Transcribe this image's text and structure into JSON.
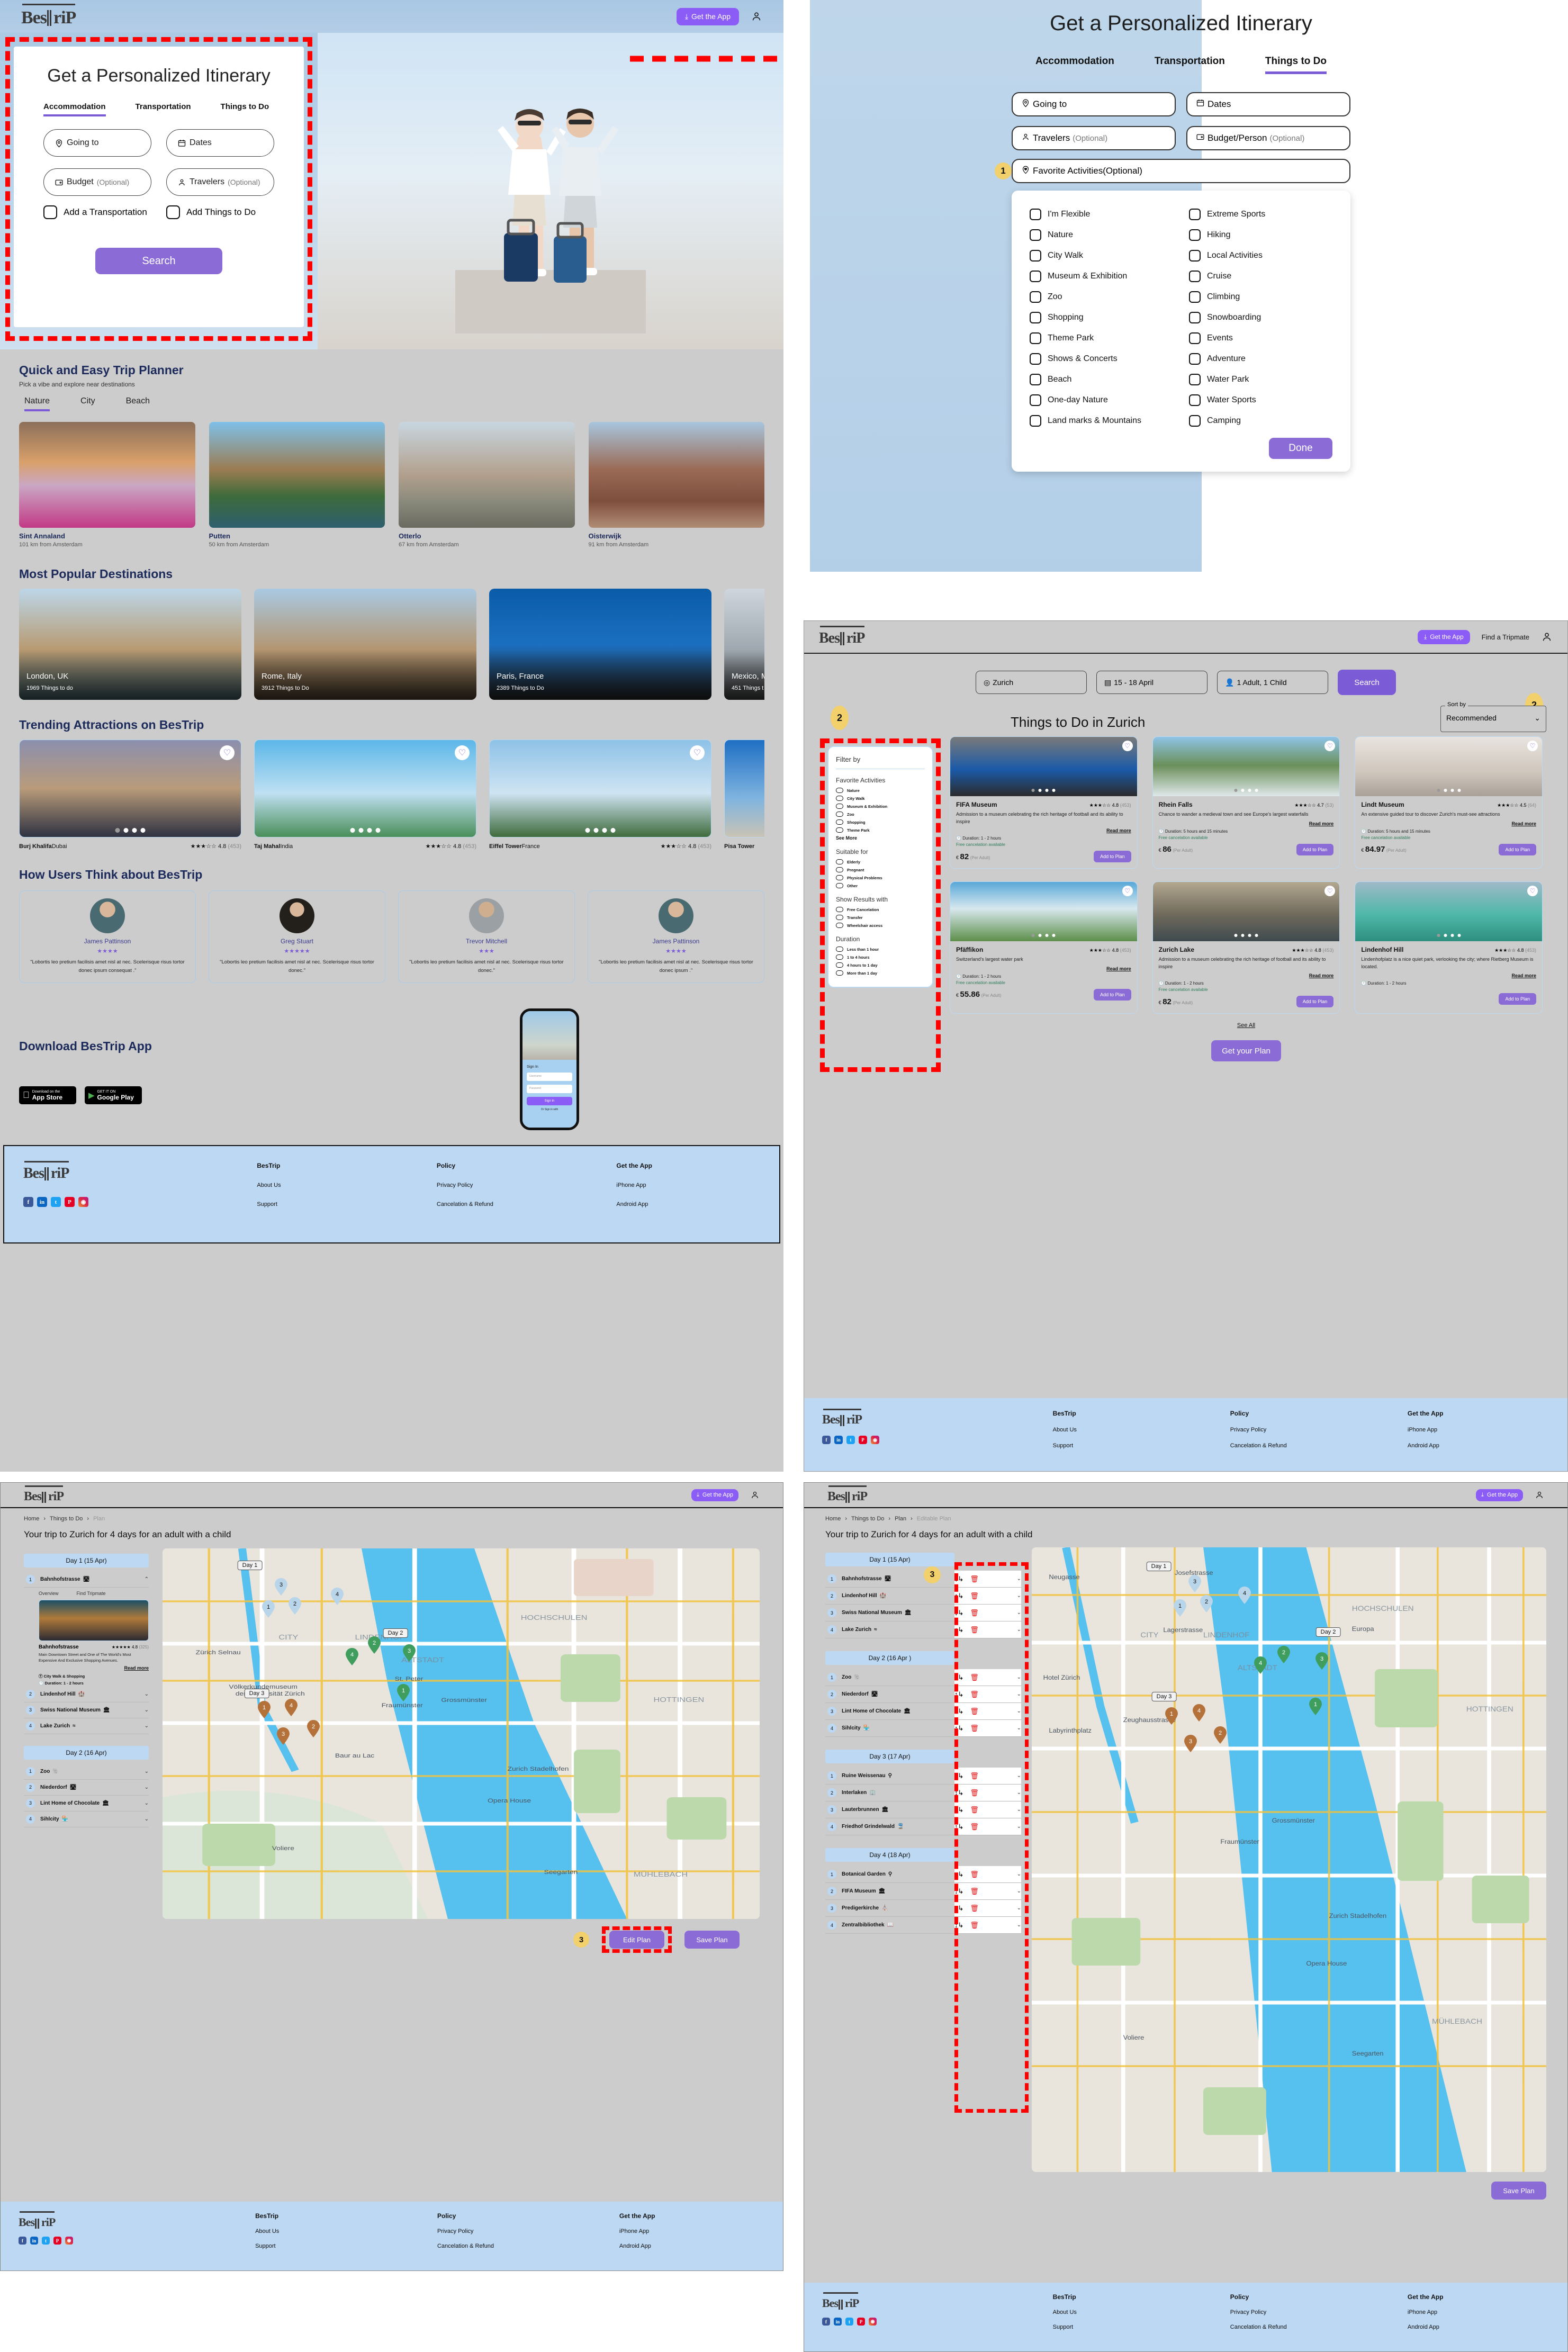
{
  "brand": {
    "name": "BesTriP",
    "get_app": "Get the App",
    "find_tripmate": "Find a Tripmate"
  },
  "home": {
    "form": {
      "title": "Get a Personalized Itinerary",
      "tabs": [
        "Accommodation",
        "Transportation",
        "Things to Do"
      ],
      "active_tab": "Accommodation",
      "fields": {
        "going_to": "Going to",
        "dates": "Dates",
        "budget": "Budget",
        "budget_opt": "(Optional)",
        "travelers": "Travelers",
        "travelers_opt": "(Optional)"
      },
      "checkboxes": [
        "Add a Transportation",
        "Add Things to Do"
      ],
      "search_button": "Search"
    },
    "planner": {
      "title": "Quick and Easy Trip Planner",
      "subtitle": "Pick a vibe and explore near destinations",
      "tabs": [
        "Nature",
        "City",
        "Beach"
      ],
      "active_tab": "Nature",
      "tiles": [
        {
          "name": "Sint Annaland",
          "distance": "101 km from Amsterdam"
        },
        {
          "name": "Putten",
          "distance": "50 km from Amsterdam"
        },
        {
          "name": "Otterlo",
          "distance": "67 km from Amsterdam"
        },
        {
          "name": "Oisterwijk",
          "distance": "91 km from Amsterdam"
        }
      ]
    },
    "popular": {
      "title": "Most Popular Destinations",
      "cards": [
        {
          "name": "London, UK",
          "count": "1969 Things to do"
        },
        {
          "name": "Rome, Italy",
          "count": "3912 Things to Do"
        },
        {
          "name": "Paris, France",
          "count": "2389 Things to Do"
        },
        {
          "name": "Mexico, M",
          "count": "451 Things t"
        }
      ]
    },
    "trending": {
      "title": "Trending Attractions on BesTrip",
      "cards": [
        {
          "name": "Burj Khalifa",
          "place": "Dubai",
          "stars": "★★★☆☆",
          "rating": "4.8",
          "reviews": "(453)"
        },
        {
          "name": "Taj Mahal",
          "place": "India",
          "stars": "★★★☆☆",
          "rating": "4.8",
          "reviews": "(453)"
        },
        {
          "name": "Eiffel Tower",
          "place": "France",
          "stars": "★★★☆☆",
          "rating": "4.8",
          "reviews": "(453)"
        },
        {
          "name": "Pisa Tower",
          "place": "",
          "stars": "",
          "rating": "",
          "reviews": ""
        }
      ]
    },
    "reviews": {
      "title": "How Users Think about BesTrip",
      "items": [
        {
          "name": "James Pattinson",
          "stars": "★★★★",
          "text": "\"Lobortis leo pretium facilisis amet nisl at nec. Scelerisque risus tortor donec ipsum consequat .\""
        },
        {
          "name": "Greg Stuart",
          "stars": "★★★★★",
          "text": "\"Lobortis leo pretium facilisis amet nisl at nec. Scelerisque risus tortor donec.\""
        },
        {
          "name": "Trevor Mitchell",
          "stars": "★★★",
          "text": "\"Lobortis leo pretium facilisis amet nisl at nec. Scelerisque risus tortor donec.\""
        },
        {
          "name": "James Pattinson",
          "stars": "★★★★",
          "text": "\"Lobortis leo pretium facilisis amet nisl at nec. Scelerisque risus tortor donec ipsum .\""
        }
      ]
    },
    "download": {
      "title": "Download BesTrip App",
      "appstore_small": "Download on the",
      "appstore_big": "App Store",
      "play_small": "GET IT ON",
      "play_big": "Google Play",
      "phone": {
        "signin": "Sign In",
        "username_placeholder": "Username",
        "password_placeholder": "Password",
        "signin_button": "Sign In",
        "note": "Or Sign in with"
      }
    }
  },
  "footer": {
    "columns": [
      {
        "heading": "BesTrip",
        "links": [
          "About Us",
          "Support"
        ]
      },
      {
        "heading": "Policy",
        "links": [
          "Privacy Policy",
          "Cancelation & Refund"
        ]
      },
      {
        "heading": "Get the App",
        "links": [
          "iPhone App",
          "Android App"
        ]
      }
    ],
    "socials": [
      "facebook-icon",
      "linkedin-icon",
      "twitter-icon",
      "pinterest-icon",
      "instagram-icon"
    ]
  },
  "itinerary_form": {
    "title": "Get a Personalized Itinerary",
    "tabs": [
      "Accommodation",
      "Transportation",
      "Things to Do"
    ],
    "active_tab": "Things to Do",
    "fields": {
      "going_to": "Going to",
      "dates": "Dates",
      "travelers": "Travelers",
      "travelers_opt": "(Optional)",
      "budget_person": "Budget/Person",
      "budget_opt": "(Optional)",
      "favorite_activities": "Favorite Activities",
      "favorite_opt": "(Optional)"
    },
    "step_badge": "1",
    "activities_left": [
      "I'm Flexible",
      "Nature",
      "City Walk",
      "Museum & Exhibition",
      "Zoo",
      "Shopping",
      "Theme Park",
      "Shows & Concerts",
      "Beach",
      "One-day Nature",
      "Land marks & Mountains"
    ],
    "activities_right": [
      "Extreme Sports",
      "Hiking",
      "Local Activities",
      "Cruise",
      "Climbing",
      "Snowboarding",
      "Events",
      "Adventure",
      "Water Park",
      "Water Sports",
      "Camping"
    ],
    "done_button": "Done"
  },
  "things_to_do": {
    "step_badge_left": "2",
    "step_badge_right": "2",
    "search": {
      "destination": "Zurich",
      "dates": "15 - 18 April",
      "travelers": "1 Adult, 1 Child",
      "button": "Search"
    },
    "heading": "Things to Do in Zurich",
    "sort": {
      "label": "Sort by",
      "value": "Recommended"
    },
    "filter": {
      "title": "Filter by",
      "groups": [
        {
          "name": "Favorite Activities",
          "options": [
            "Nature",
            "City Walk",
            "Museum & Exhibition",
            "Zoo",
            "Shopping",
            "Theme Park"
          ],
          "see_more": "See More"
        },
        {
          "name": "Suitable for",
          "options": [
            "Elderly",
            "Pregnant",
            "Physical Problems",
            "Other"
          ]
        },
        {
          "name": "Show Results with",
          "options": [
            "Free Cancelation",
            "Transfer",
            "Wheelchair access"
          ]
        },
        {
          "name": "Duration",
          "options": [
            "Less than 1 hour",
            "1 to 4 hours",
            "4 hours to 1 day",
            "More than 1 day"
          ]
        }
      ]
    },
    "cards": [
      {
        "title": "FIFA Museum",
        "stars": "★★★☆☆",
        "rating": "4.8",
        "reviews": "(453)",
        "desc": "Admission to a museum celebrating the rich heritage of football and its ability to inspire",
        "read_more": "Read more",
        "duration": "Duration: 1 - 2 hours",
        "cancel": "Free cancelation available",
        "currency": "€",
        "price": "82",
        "per": "(Per Adult)",
        "cta": "Add to Plan"
      },
      {
        "title": "Rhein Falls",
        "stars": "★★★☆☆",
        "rating": "4.7",
        "reviews": "(53)",
        "desc": "Chance to wander a medieval town and see Europe's largest waterfalls",
        "read_more": "Read more",
        "duration": "Duration: 5 hours and 15 minutes",
        "cancel": "Free cancelation available",
        "currency": "€",
        "price": "86",
        "per": "(Per Adult)",
        "cta": "Add to Plan"
      },
      {
        "title": "Lindt Museum",
        "stars": "★★★☆☆",
        "rating": "4.5",
        "reviews": "(64)",
        "desc": "An extensive guided tour to discover Zurich's must-see attractions",
        "read_more": "Read more",
        "duration": "Duration: 5 hours and 15 minutes",
        "cancel": "Free cancelation available",
        "currency": "€",
        "price": "84.97",
        "per": "(Per Adult)",
        "cta": "Add to Plan"
      },
      {
        "title": "Pfäffikon",
        "stars": "★★★☆☆",
        "rating": "4.8",
        "reviews": "(453)",
        "desc": "Switzerland's largest water park",
        "read_more": "Read more",
        "duration": "Duration: 1 - 2 hours",
        "cancel": "Free cancelation available",
        "currency": "€",
        "price": "55.86",
        "per": "(Per Adult)",
        "cta": "Add to Plan"
      },
      {
        "title": "Zurich Lake",
        "stars": "★★★☆☆",
        "rating": "4.8",
        "reviews": "(453)",
        "desc": "Admission to a museum celebrating the rich heritage of football and its ability to inspire",
        "read_more": "Read more",
        "duration": "Duration: 1 - 2 hours",
        "cancel": "Free cancelation available",
        "currency": "€",
        "price": "82",
        "per": "(Per Adult)",
        "cta": "Add to Plan"
      },
      {
        "title": "Lindenhof Hill",
        "stars": "★★★☆☆",
        "rating": "4.8",
        "reviews": "(453)",
        "desc": "Lindenhofplatz is a nice quiet park, verlooking the city; where Rietberg Museum is located.",
        "read_more": "Read more",
        "duration": "Duration: 1 - 2 hours",
        "cancel": "",
        "currency": "",
        "price": "",
        "per": "",
        "cta": "Add to Plan"
      }
    ],
    "see_all": "See All",
    "get_plan": "Get your Plan"
  },
  "plan": {
    "breadcrumb": [
      "Home",
      "Things to Do",
      "Plan"
    ],
    "title": "Your trip to Zurich for 4 days for an adult with a child",
    "step_badge": "3",
    "days": [
      {
        "label": "Day 1 (15 Apr)",
        "items": [
          {
            "n": "1",
            "name": "Bahnhofstrasse",
            "icon": "road-icon"
          },
          {
            "n": "2",
            "name": "Lindenhof Hill",
            "icon": "castle-icon"
          },
          {
            "n": "3",
            "name": "Swiss National Museum",
            "icon": "museum-icon"
          },
          {
            "n": "4",
            "name": "Lake Zurich",
            "icon": "water-icon"
          }
        ]
      },
      {
        "label": "Day 2 (16 Apr)",
        "items": [
          {
            "n": "1",
            "name": "Zoo",
            "icon": "elephant-icon"
          },
          {
            "n": "2",
            "name": "Niederdorf",
            "icon": "road-icon"
          },
          {
            "n": "3",
            "name": "Lint Home of Chocolate",
            "icon": "museum-icon"
          },
          {
            "n": "4",
            "name": "Sihlcity",
            "icon": "shop-icon"
          }
        ]
      }
    ],
    "expanded": {
      "tabs": [
        "Overview",
        "Find Tripmate"
      ],
      "name": "Bahnhofstrasse",
      "stars": "★★★★★",
      "rating": "4.8",
      "reviews": "(325)",
      "desc": "Main Downtown Street and One of The World's Most Expensive And Exclusive Shopping Avenues.",
      "read_more": "Read more",
      "category": "City Walk & Shopping",
      "duration": "Duration: 1 - 2 hours"
    },
    "map_labels": [
      "Day 1",
      "Day 2",
      "Day 3"
    ],
    "buttons": {
      "edit": "Edit Plan",
      "save": "Save Plan"
    }
  },
  "editable_plan": {
    "breadcrumb": [
      "Home",
      "Things to Do",
      "Plan",
      "Editable Plan"
    ],
    "title": "Your trip to Zurich for 4 days for an adult with a child",
    "step_badge": "3",
    "days": [
      {
        "label": "Day 1 (15 Apr)",
        "items": [
          {
            "n": "1",
            "name": "Bahnhofstrasse",
            "icon": "road-icon"
          },
          {
            "n": "2",
            "name": "Lindenhof Hill",
            "icon": "castle-icon"
          },
          {
            "n": "3",
            "name": "Swiss National Museum",
            "icon": "museum-icon"
          },
          {
            "n": "4",
            "name": "Lake Zurich",
            "icon": "water-icon"
          }
        ]
      },
      {
        "label": "Day 2 (16 Apr )",
        "items": [
          {
            "n": "1",
            "name": "Zoo",
            "icon": "elephant-icon"
          },
          {
            "n": "2",
            "name": "Niederdorf",
            "icon": "road-icon"
          },
          {
            "n": "3",
            "name": "Lint Home of Chocolate",
            "icon": "museum-icon"
          },
          {
            "n": "4",
            "name": "Sihlcity",
            "icon": "shop-icon"
          }
        ]
      },
      {
        "label": "Day 3 (17 Apr)",
        "items": [
          {
            "n": "1",
            "name": "Ruine Weissenau",
            "icon": "tree-icon"
          },
          {
            "n": "2",
            "name": "Interlaken",
            "icon": "city-icon"
          },
          {
            "n": "3",
            "name": "Lauterbrunnen",
            "icon": "village-icon"
          },
          {
            "n": "4",
            "name": "Friedhof Grindelwald",
            "icon": "train-icon"
          }
        ]
      },
      {
        "label": "Day 4 (18 Apr)",
        "items": [
          {
            "n": "1",
            "name": "Botanical Garden",
            "icon": "tree-icon"
          },
          {
            "n": "2",
            "name": "FIFA Museum",
            "icon": "museum-icon"
          },
          {
            "n": "3",
            "name": "Predigerkirche",
            "icon": "church-icon"
          },
          {
            "n": "4",
            "name": "Zentralbibliothek",
            "icon": "book-icon"
          }
        ]
      }
    ],
    "map_labels": [
      "Day 1",
      "Day 2",
      "Day 3"
    ],
    "save_button": "Save Plan"
  },
  "colors": {
    "accent": "#8b6cd6",
    "footer_bg": "#bdd8f2",
    "annotation": "#ff0000",
    "badge": "#f2d06b",
    "green_text": "#2e7d5b"
  }
}
